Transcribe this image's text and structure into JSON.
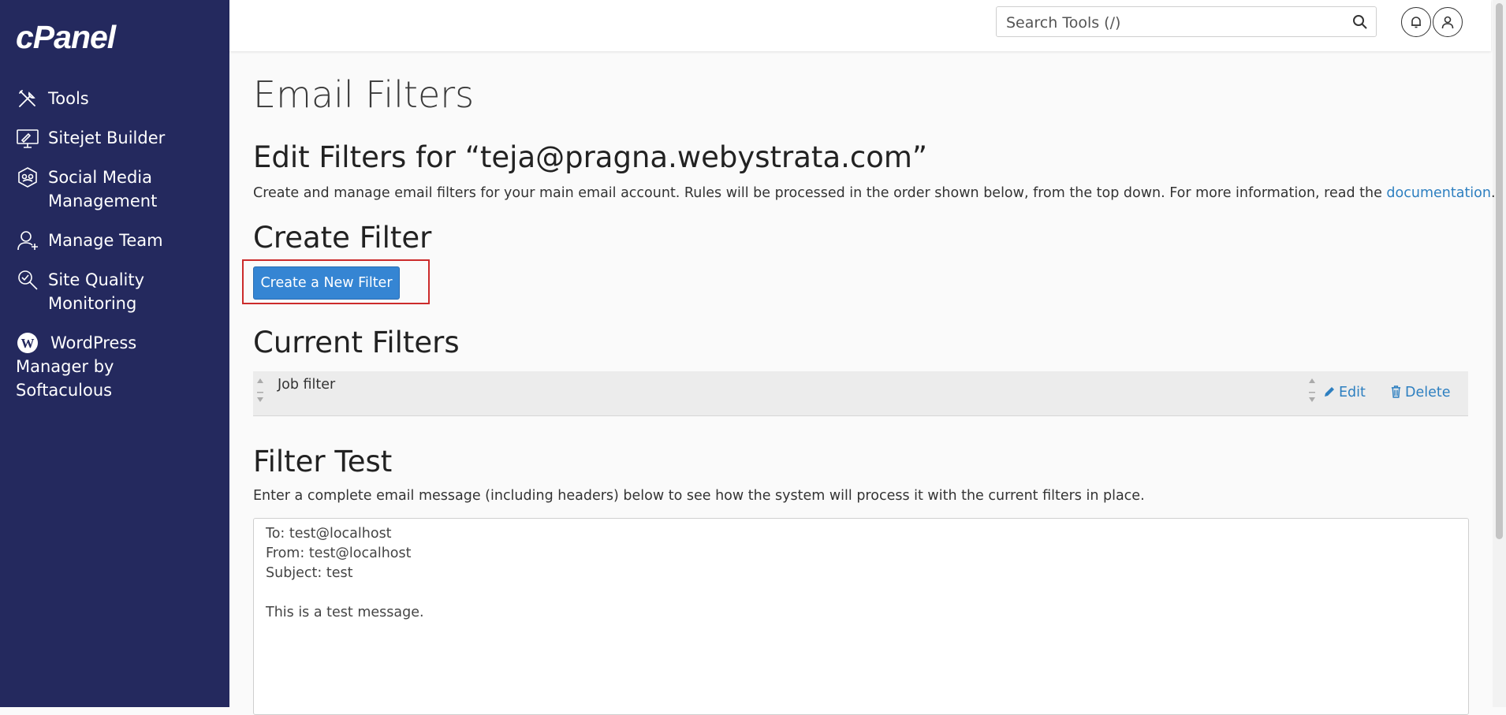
{
  "brand": {
    "logo_text": "cPanel"
  },
  "sidebar": {
    "items": [
      {
        "label": "Tools",
        "icon": "tools-icon"
      },
      {
        "label": "Sitejet Builder",
        "icon": "monitor-brush-icon"
      },
      {
        "label": "Social Media\nManagement",
        "icon": "social-media-icon"
      },
      {
        "label": "Manage Team",
        "icon": "team-user-icon"
      },
      {
        "label": "Site Quality\nMonitoring",
        "icon": "magnify-check-icon"
      },
      {
        "label": "WordPress\nManager by\nSoftaculous",
        "icon": "wordpress-icon"
      }
    ]
  },
  "header": {
    "search": {
      "placeholder": "Search Tools (/)",
      "icon": "search-icon"
    },
    "notifications_icon": "bell-icon",
    "user_icon": "user-icon"
  },
  "main": {
    "page_title": "Email Filters",
    "edit_heading": "Edit Filters for “teja@pragna.webystrata.com”",
    "intro_text": "Create and manage email filters for your main email account. Rules will be processed in the order shown below, from the top down. For more information, read the ",
    "intro_link": "documentation",
    "intro_end": ".",
    "create_section": {
      "heading": "Create Filter",
      "button_label": "Create a New Filter",
      "highlight_color": "#cc2b2b"
    },
    "current_section": {
      "heading": "Current Filters",
      "filters": [
        {
          "name": "Job filter",
          "edit_label": "Edit",
          "delete_label": "Delete"
        }
      ]
    },
    "test_section": {
      "heading": "Filter Test",
      "description": "Enter a complete email message (including headers) below to see how the system will process it with the current filters in place.",
      "textarea_value": "To: test@localhost\nFrom: test@localhost\nSubject: test\n\nThis is a test message."
    }
  },
  "colors": {
    "sidebar_bg": "#24295e",
    "accent": "#3585d3",
    "link": "#2d7fc0",
    "page_bg": "#fafafa"
  }
}
